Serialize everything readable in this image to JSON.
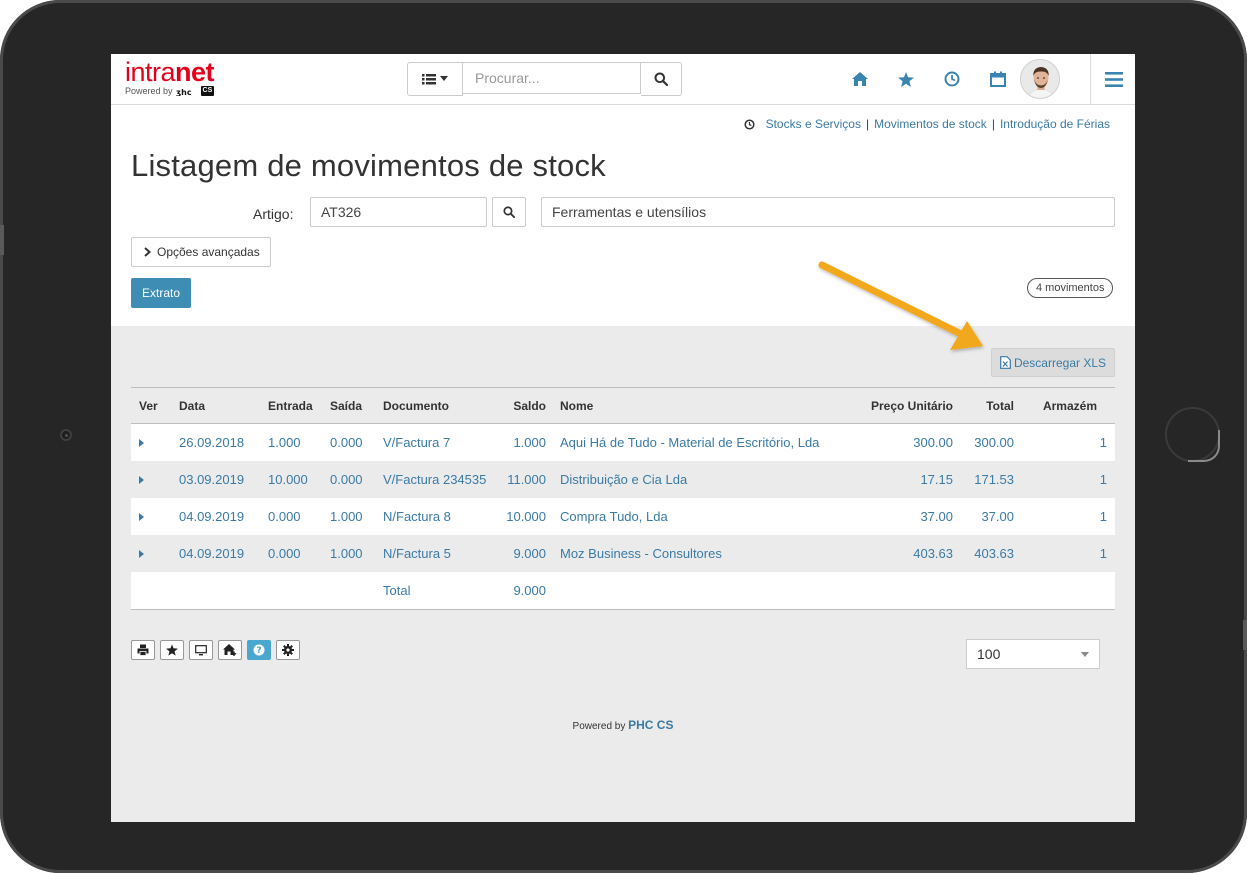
{
  "logo": {
    "main_light": "intra",
    "main_bold": "net",
    "sub": "Powered by",
    "sub_brand": "CS"
  },
  "search": {
    "placeholder": "Procurar..."
  },
  "top_icons": [
    "home-icon",
    "star-icon",
    "clock-icon",
    "calendar-icon"
  ],
  "breadcrumb": {
    "items": [
      "Stocks e Serviços",
      "Movimentos de stock",
      "Introdução de Férias"
    ],
    "sep": "|"
  },
  "page": {
    "title": "Listagem de movimentos de stock"
  },
  "filter": {
    "artigo_label": "Artigo:",
    "artigo_value": "AT326",
    "description": "Ferramentas e utensílios",
    "advanced_label": "Opções avançadas",
    "extrato_label": "Extrato",
    "count_badge": "4 movimentos"
  },
  "actions": {
    "download_xls": "Descarregar XLS"
  },
  "table": {
    "headers": [
      "Ver",
      "Data",
      "Entrada",
      "Saída",
      "Documento",
      "Saldo",
      "Nome",
      "Preço Unitário",
      "Total",
      "Armazém"
    ],
    "rows": [
      {
        "date": "26.09.2018",
        "in": "1.000",
        "out": "0.000",
        "doc": "V/Factura 7",
        "balance": "1.000",
        "name": "Aqui Há de Tudo - Material de Escritório, Lda",
        "price": "300.00",
        "total": "300.00",
        "warehouse": "1"
      },
      {
        "date": "03.09.2019",
        "in": "10.000",
        "out": "0.000",
        "doc": "V/Factura 234535",
        "balance": "11.000",
        "name": "Distribuição e Cia Lda",
        "price": "17.15",
        "total": "171.53",
        "warehouse": "1"
      },
      {
        "date": "04.09.2019",
        "in": "0.000",
        "out": "1.000",
        "doc": "N/Factura 8",
        "balance": "10.000",
        "name": "Compra Tudo, Lda",
        "price": "37.00",
        "total": "37.00",
        "warehouse": "1"
      },
      {
        "date": "04.09.2019",
        "in": "0.000",
        "out": "1.000",
        "doc": "N/Factura 5",
        "balance": "9.000",
        "name": "Moz Business - Consultores",
        "price": "403.63",
        "total": "403.63",
        "warehouse": "1"
      }
    ],
    "total_label": "Total",
    "total_value": "9.000"
  },
  "toolbar": {
    "tools": [
      "print-icon",
      "star-icon",
      "monitor-icon",
      "home-add-icon",
      "help-icon",
      "gear-icon"
    ]
  },
  "pagination": {
    "per_page": "100"
  },
  "footer": {
    "powered_prefix": "Powered by",
    "powered_brand": "PHC CS"
  },
  "colors": {
    "accent": "#3a85b0",
    "link": "#3a7aa5",
    "brand_red": "#e3001b",
    "arrow": "#f2a81d"
  }
}
